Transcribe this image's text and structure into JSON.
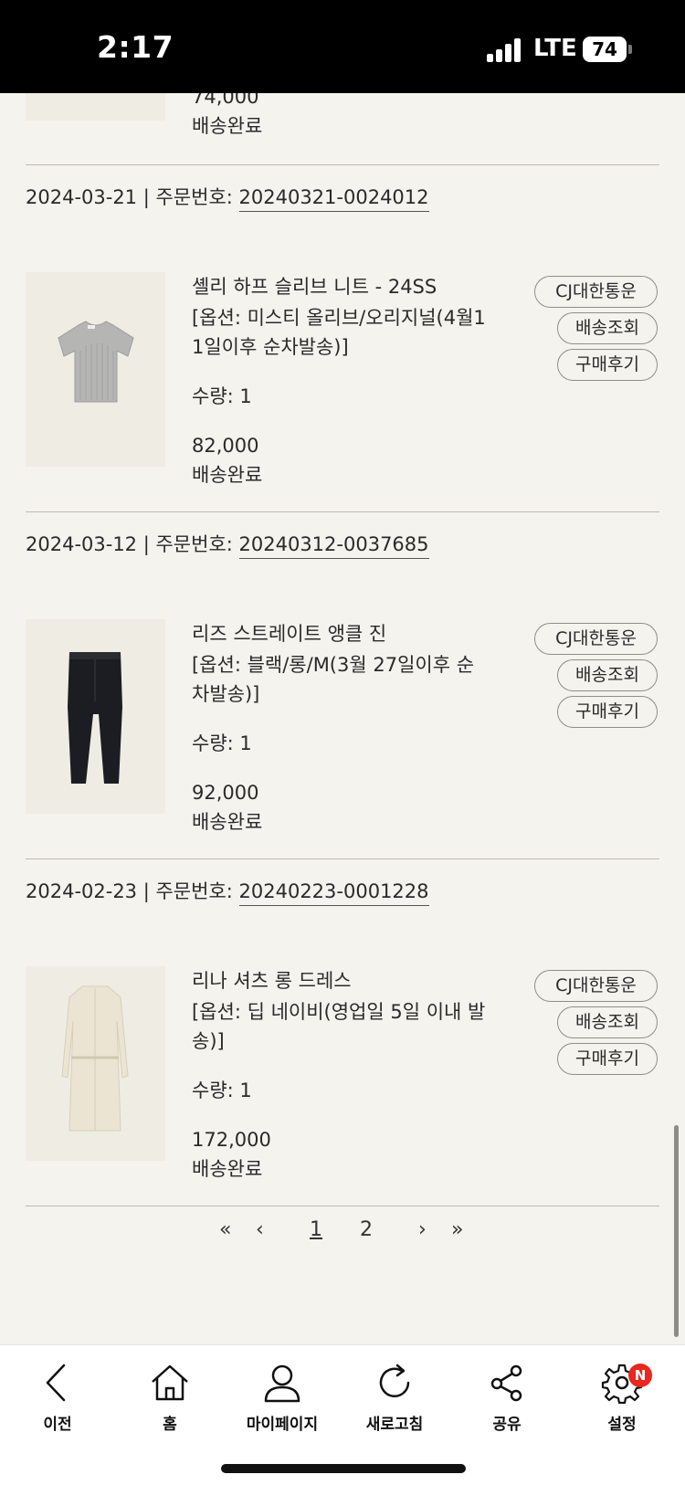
{
  "status_bar": {
    "time": "2:17",
    "network": "LTE",
    "battery": "74"
  },
  "top_partial": {
    "price": "74,000",
    "status": "배송완료"
  },
  "orders": [
    {
      "date": "2024-03-21",
      "separator": " | ",
      "order_label": "주문번호: ",
      "order_number": "20240321-0024012",
      "product_name": "셸리 하프 슬리브 니트 - 24SS",
      "option_line1": "[옵션: 미스티 올리브/오리지널(4월1",
      "option_line2": "1일이후 순차발송)]",
      "quantity": "수량: 1",
      "price": "82,000",
      "status": "배송완료",
      "buttons": [
        "CJ대한통운",
        "배송조회",
        "구매후기"
      ]
    },
    {
      "date": "2024-03-12",
      "separator": " | ",
      "order_label": "주문번호: ",
      "order_number": "20240312-0037685",
      "product_name": "리즈 스트레이트 앵클 진",
      "option_line1": "[옵션: 블랙/롱/M(3월 27일이후 순",
      "option_line2": "차발송)]",
      "quantity": "수량: 1",
      "price": "92,000",
      "status": "배송완료",
      "buttons": [
        "CJ대한통운",
        "배송조회",
        "구매후기"
      ]
    },
    {
      "date": "2024-02-23",
      "separator": " | ",
      "order_label": "주문번호: ",
      "order_number": "20240223-0001228",
      "product_name": "리나 셔츠 롱 드레스",
      "option_line1": "[옵션: 딥 네이비(영업일 5일 이내 발",
      "option_line2": "송)]",
      "quantity": "수량: 1",
      "price": "172,000",
      "status": "배송완료",
      "buttons": [
        "CJ대한통운",
        "배송조회",
        "구매후기"
      ]
    }
  ],
  "pagination": {
    "first": "«",
    "prev": "‹",
    "pages": [
      "1",
      "2"
    ],
    "next": "›",
    "last": "»"
  },
  "bottom_nav": [
    {
      "label": "이전",
      "icon": "back-icon"
    },
    {
      "label": "홈",
      "icon": "home-icon"
    },
    {
      "label": "마이페이지",
      "icon": "user-icon"
    },
    {
      "label": "새로고침",
      "icon": "refresh-icon"
    },
    {
      "label": "공유",
      "icon": "share-icon"
    },
    {
      "label": "설정",
      "icon": "gear-icon",
      "badge": "N"
    }
  ]
}
